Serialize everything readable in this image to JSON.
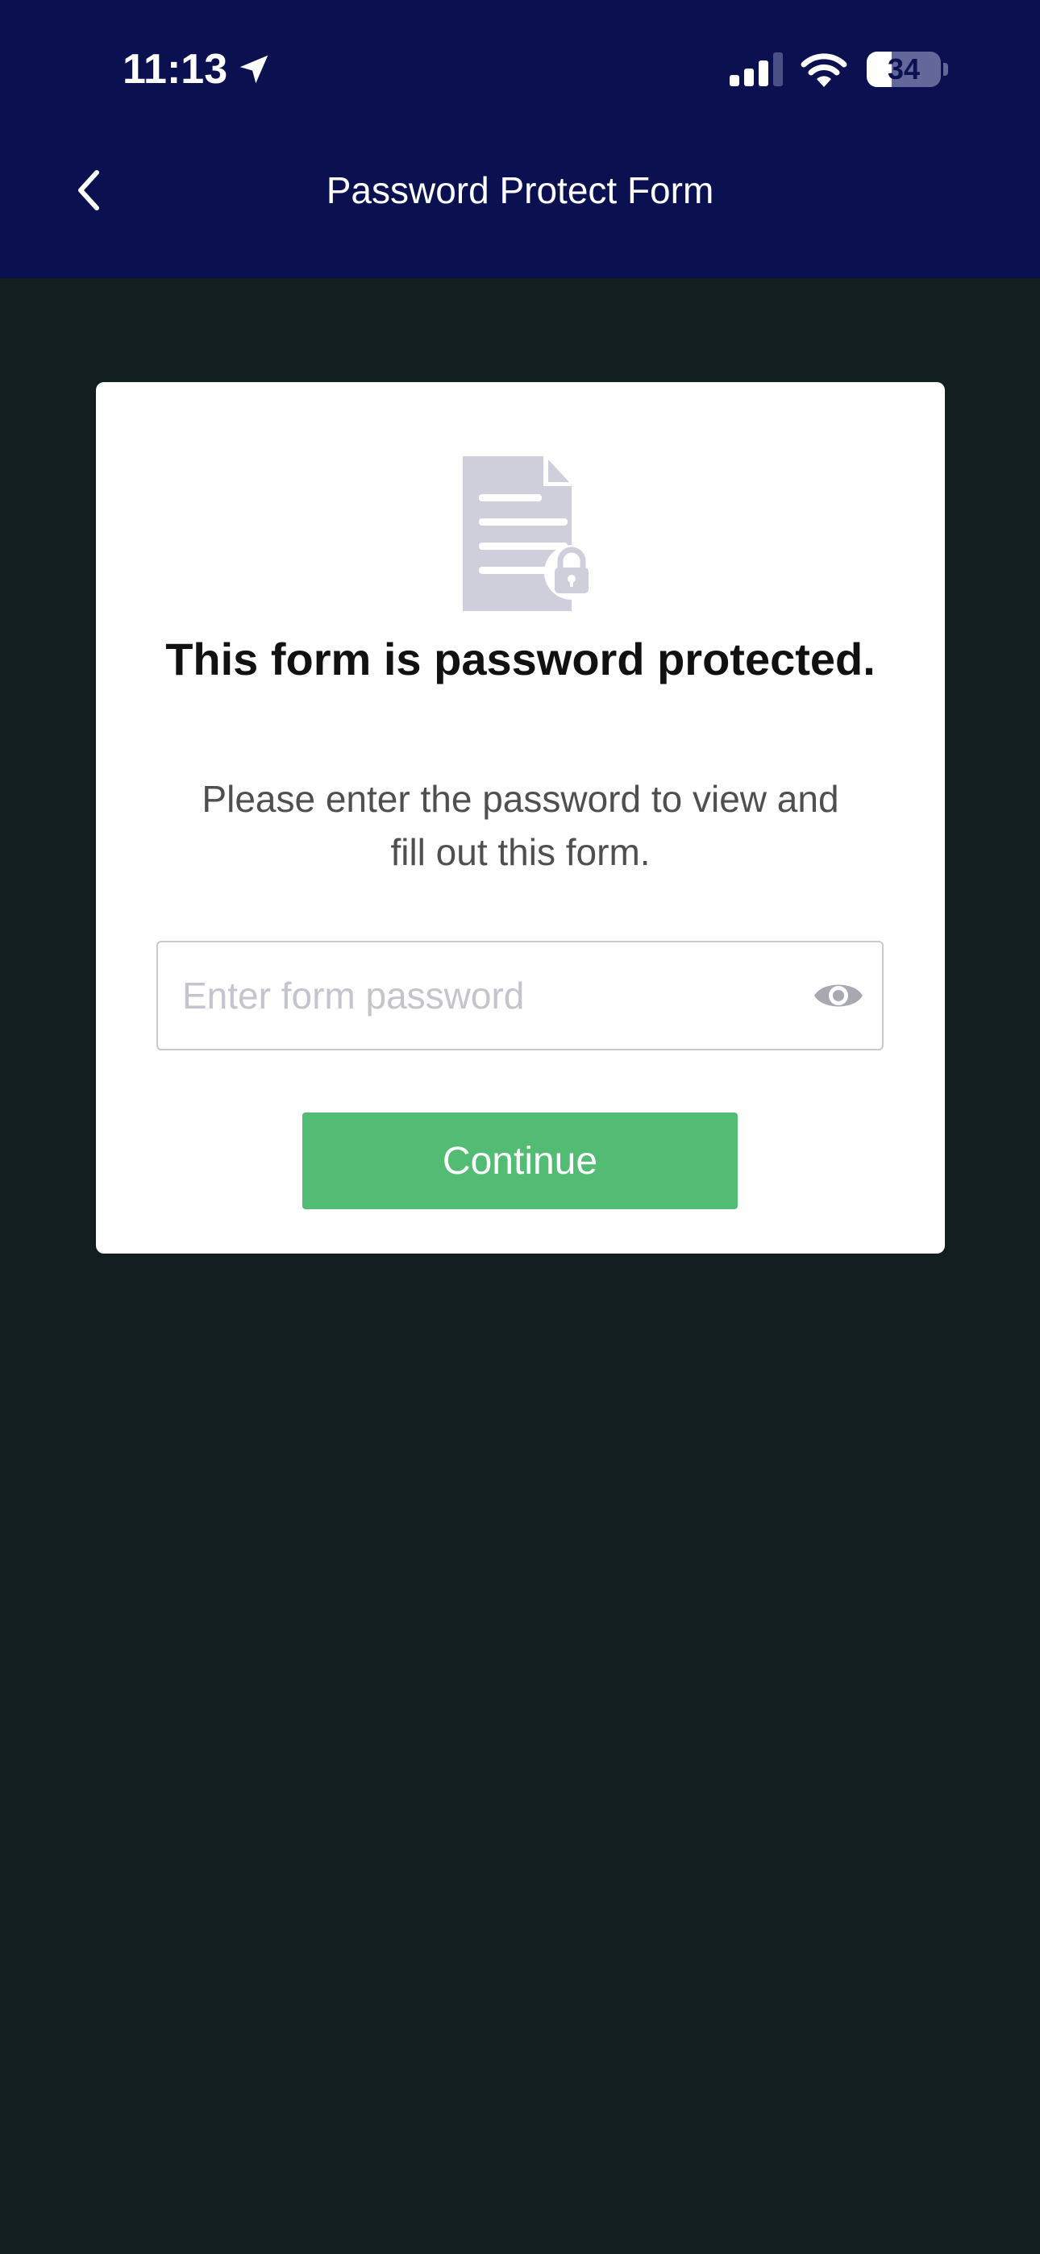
{
  "status_bar": {
    "time": "11:13",
    "battery": "34",
    "battery_level_percent": 34
  },
  "header": {
    "back_icon": "chevron-left-icon",
    "title": "Password Protect Form"
  },
  "card": {
    "icon": "locked-document-icon",
    "title": "This form is password protected.",
    "subtitle": "Please enter the password to view and fill out this form.",
    "password_field": {
      "value": "",
      "placeholder": "Enter form password",
      "toggle_icon": "eye-icon"
    },
    "continue_label": "Continue"
  },
  "colors": {
    "header_bg": "#0b1150",
    "page_bg": "#121e1f",
    "card_bg": "#ffffff",
    "button_green": "#53bc74",
    "icon_gray": "#cfcfdc"
  }
}
